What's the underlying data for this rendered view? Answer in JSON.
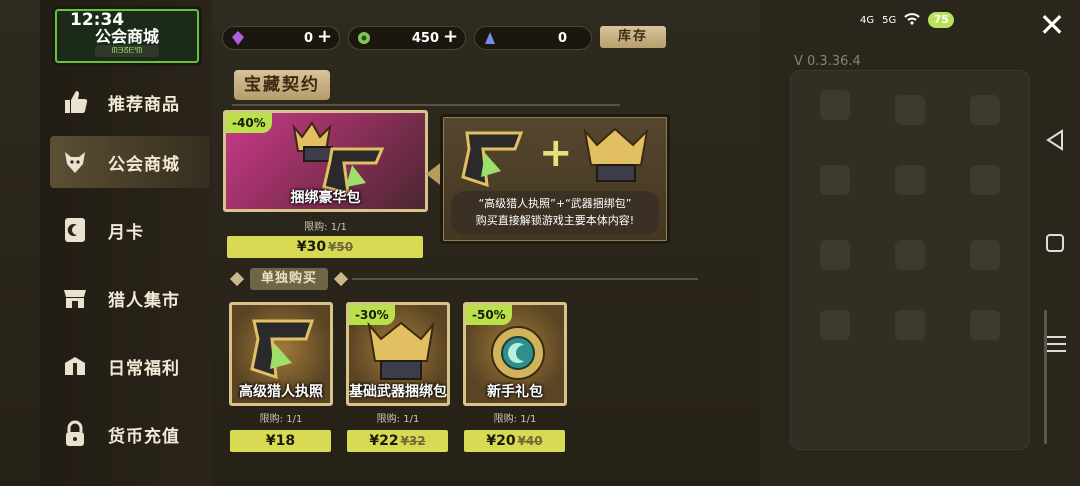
{
  "status_bar": {
    "time": "12:34",
    "signal1": "4G",
    "signal2": "5G",
    "battery": "75"
  },
  "header": {
    "title": "公会商城",
    "subtitle": "ᗰᗱᘔᗴᓫᗰ"
  },
  "currencies": [
    {
      "icon": "purple-gem-icon",
      "value": "0",
      "plus": "+"
    },
    {
      "icon": "green-coin-icon",
      "value": "450",
      "plus": "+"
    },
    {
      "icon": "blue-crystal-icon",
      "value": "0"
    }
  ],
  "stock_button": "库存",
  "version": "V 0.3.36.4",
  "sidebar": {
    "items": [
      {
        "label": "推荐商品",
        "icon": "thumbs-up-icon"
      },
      {
        "label": "公会商城",
        "icon": "wolf-emblem-icon"
      },
      {
        "label": "月卡",
        "icon": "card-icon"
      },
      {
        "label": "猎人集市",
        "icon": "market-stall-icon"
      },
      {
        "label": "日常福利",
        "icon": "gift-box-icon"
      },
      {
        "label": "货币充值",
        "icon": "lock-icon"
      }
    ],
    "active_index": 1
  },
  "section": {
    "title": "宝藏契约"
  },
  "featured": {
    "discount": "-40%",
    "name": "捆绑豪华包",
    "limit": "限购: 1/1",
    "price": "¥30",
    "old_price": "¥50"
  },
  "info_panel": {
    "plus": "+",
    "line1": "“高级猎人执照”+“武器捆绑包”",
    "line2": "购买直接解锁游戏主要本体内容!"
  },
  "single_header": "单独购买",
  "single_items": [
    {
      "discount": "",
      "name": "高级猎人执照",
      "limit": "限购: 1/1",
      "price": "¥18",
      "old_price": ""
    },
    {
      "discount": "-30%",
      "name": "基础武器捆绑包",
      "limit": "限购: 1/1",
      "price": "¥22",
      "old_price": "¥32"
    },
    {
      "discount": "-50%",
      "name": "新手礼包",
      "limit": "限购: 1/1",
      "price": "¥20",
      "old_price": "¥40"
    }
  ],
  "close_label": "✕",
  "colors": {
    "accent_green": "#b9e24a",
    "price_yellow": "#d7da52",
    "frame_gold": "#d8c489"
  }
}
